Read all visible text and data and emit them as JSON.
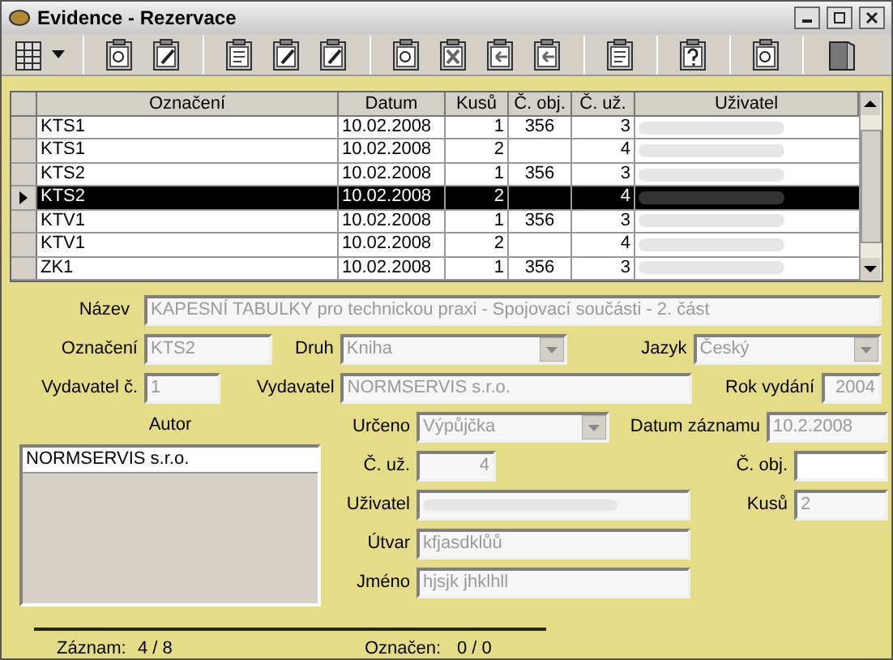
{
  "window": {
    "title": "Evidence - Rezervace"
  },
  "table": {
    "columns": [
      "Označení",
      "Datum",
      "Kusů",
      "Č. obj.",
      "Č. už.",
      "Uživatel"
    ],
    "rows": [
      {
        "cells": [
          "KTS1",
          "10.02.2008",
          "1",
          "356",
          "3"
        ],
        "selected": false
      },
      {
        "cells": [
          "KTS1",
          "10.02.2008",
          "2",
          "",
          "4"
        ],
        "selected": false
      },
      {
        "cells": [
          "KTS2",
          "10.02.2008",
          "1",
          "356",
          "3"
        ],
        "selected": false
      },
      {
        "cells": [
          "KTS2",
          "10.02.2008",
          "2",
          "",
          "4"
        ],
        "selected": true
      },
      {
        "cells": [
          "KTV1",
          "10.02.2008",
          "1",
          "356",
          "3"
        ],
        "selected": false
      },
      {
        "cells": [
          "KTV1",
          "10.02.2008",
          "2",
          "",
          "4"
        ],
        "selected": false
      },
      {
        "cells": [
          "ZK1",
          "10.02.2008",
          "1",
          "356",
          "3"
        ],
        "selected": false
      }
    ]
  },
  "form": {
    "nazev": {
      "label": "Název",
      "value": "KAPESNÍ TABULKY pro technickou praxi - Spojovací součásti - 2. část",
      "disabled": true
    },
    "oznaceni": {
      "label": "Označení",
      "value": "KTS2",
      "disabled": true
    },
    "druh": {
      "label": "Druh",
      "value": "Kniha",
      "disabled": true
    },
    "jazyk": {
      "label": "Jazyk",
      "value": "Český",
      "disabled": true
    },
    "vydavatel_c": {
      "label": "Vydavatel č.",
      "value": "1",
      "disabled": true
    },
    "vydavatel": {
      "label": "Vydavatel",
      "value": "NORMSERVIS s.r.o.",
      "disabled": true
    },
    "rok_vydani": {
      "label": "Rok vydání",
      "value": "2004",
      "disabled": true
    },
    "autor": {
      "label": "Autor",
      "items": [
        "NORMSERVIS s.r.o."
      ]
    },
    "urceno": {
      "label": "Určeno",
      "value": "Výpůjčka",
      "disabled": true
    },
    "datum_zaznamu": {
      "label": "Datum záznamu",
      "value": "10.2.2008",
      "disabled": true
    },
    "c_uz": {
      "label": "Č. už.",
      "value": "4",
      "disabled": true
    },
    "c_obj": {
      "label": "Č. obj."
    },
    "uzivatel": {
      "label": "Uživatel"
    },
    "kusu": {
      "label": "Kusů",
      "value": "2",
      "disabled": true
    },
    "utvar": {
      "label": "Útvar",
      "value": "kfjasdklůů",
      "disabled": true
    },
    "jmeno": {
      "label": "Jméno",
      "value": "hjsjk jhklhll",
      "disabled": true
    }
  },
  "status_bar": {
    "zaznam_label": "Záznam:",
    "zaznam_value": "4 / 8",
    "oznacen_label": "Označen:",
    "oznacen_value": "0 / 0"
  }
}
